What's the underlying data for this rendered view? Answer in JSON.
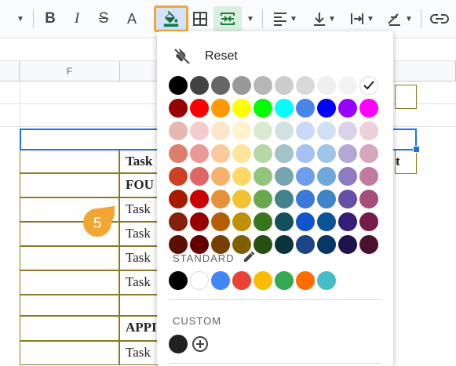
{
  "toolbar": {
    "items": [
      {
        "name": "more-formats-caret",
        "glyph": "▾"
      },
      {
        "name": "bold",
        "glyph": "B"
      },
      {
        "name": "italic",
        "glyph": "I"
      },
      {
        "name": "strikethrough",
        "glyph": "S"
      },
      {
        "name": "text-color",
        "glyph": "A"
      }
    ]
  },
  "sheet": {
    "column_header": "F",
    "rows": [
      {
        "text": "",
        "bold": false
      },
      {
        "text": "Task",
        "bold": true
      },
      {
        "text": "FOU",
        "bold": true
      },
      {
        "text": "Task",
        "bold": false
      },
      {
        "text": "Task",
        "bold": false
      },
      {
        "text": "Task",
        "bold": false
      },
      {
        "text": "Task",
        "bold": false
      },
      {
        "text": "",
        "bold": false
      },
      {
        "text": "APPI",
        "bold": true
      },
      {
        "text": "Task",
        "bold": false
      }
    ],
    "right_fragment": "t"
  },
  "step_badge": "5",
  "fill_menu": {
    "reset_label": "Reset",
    "standard_label": "STANDARD",
    "custom_label": "CUSTOM",
    "palette": [
      [
        "#000000",
        "#434343",
        "#666666",
        "#999999",
        "#b7b7b7",
        "#cccccc",
        "#d9d9d9",
        "#efefef",
        "#f3f3f3",
        "#ffffff"
      ],
      [
        "#980000",
        "#ff0000",
        "#ff9900",
        "#ffff00",
        "#00ff00",
        "#00ffff",
        "#4a86e8",
        "#0000ff",
        "#9900ff",
        "#ff00ff"
      ],
      [
        "#e6b8af",
        "#f4cccc",
        "#fce5cd",
        "#fff2cc",
        "#d9ead3",
        "#d0e0e3",
        "#c9daf8",
        "#cfe2f3",
        "#d9d2e9",
        "#ead1dc"
      ],
      [
        "#dd7e6b",
        "#ea9999",
        "#f9cb9c",
        "#ffe599",
        "#b6d7a8",
        "#a2c4c9",
        "#a4c2f4",
        "#9fc5e8",
        "#b4a7d6",
        "#d5a6bd"
      ],
      [
        "#cc4125",
        "#e06666",
        "#f6b26b",
        "#ffd966",
        "#93c47d",
        "#76a5af",
        "#6d9eeb",
        "#6fa8dc",
        "#8e7cc3",
        "#c27ba0"
      ],
      [
        "#a61c00",
        "#cc0000",
        "#e69138",
        "#f1c232",
        "#6aa84f",
        "#45818e",
        "#3c78d8",
        "#3d85c6",
        "#674ea7",
        "#a64d79"
      ],
      [
        "#85200c",
        "#990000",
        "#b45f06",
        "#bf9000",
        "#38761d",
        "#134f5c",
        "#1155cc",
        "#0b5394",
        "#351c75",
        "#741b47"
      ],
      [
        "#5b0f00",
        "#660000",
        "#783f04",
        "#7f6000",
        "#274e13",
        "#0c343d",
        "#1c4587",
        "#073763",
        "#20124d",
        "#4c1130"
      ]
    ],
    "selected_color": "#ffffff",
    "standard_colors": [
      "#000000",
      "#ffffff",
      "#4285f4",
      "#ea4335",
      "#fbbc04",
      "#34a853",
      "#ff6d01",
      "#46bdc6"
    ],
    "custom_colors": [
      "#212121"
    ],
    "icons": [
      "no-fill-icon",
      "pencil-icon",
      "add-custom-icon",
      "checkmark-icon"
    ]
  }
}
